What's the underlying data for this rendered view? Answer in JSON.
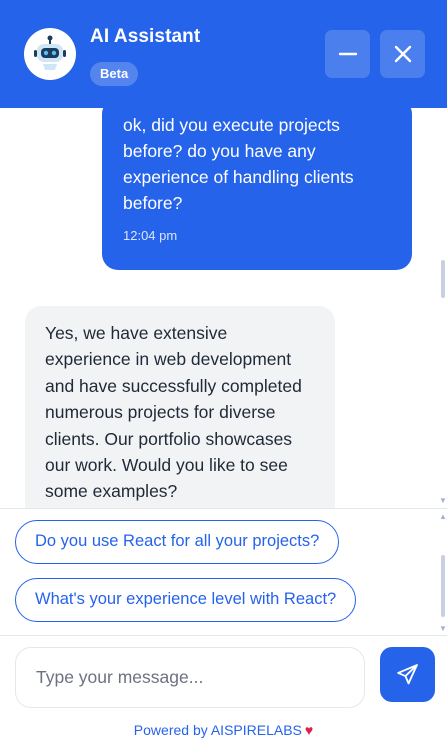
{
  "header": {
    "title": "AI Assistant",
    "badge": "Beta",
    "avatar_icon": "robot-icon",
    "minimize_icon": "minus-icon",
    "close_icon": "close-icon"
  },
  "messages": [
    {
      "role": "user",
      "text": "ok, did you execute projects before? do you have any experience of handling clients before?",
      "time": "12:04 pm"
    },
    {
      "role": "assistant",
      "text": "Yes, we have extensive experience in web development and have successfully completed numerous projects for diverse clients. Our portfolio showcases our work. Would you like to see some examples?"
    }
  ],
  "suggestions": [
    "Do you use React for all your projects?",
    "What's your experience level with React?"
  ],
  "composer": {
    "placeholder": "Type your message...",
    "value": "",
    "send_icon": "send-icon"
  },
  "footer": {
    "powered_by": "Powered by AISPIRELABS",
    "heart_icon": "heart-icon"
  },
  "colors": {
    "accent": "#2563eb",
    "bot_bubble": "#f1f3f5",
    "heart": "#e11d48"
  }
}
